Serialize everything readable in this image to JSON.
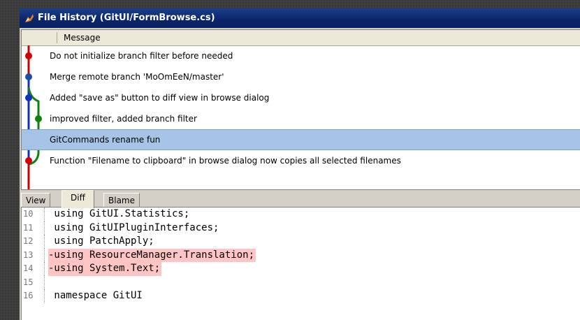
{
  "window": {
    "title": "File History (GitUI/FormBrowse.cs)",
    "icon": "git-icon"
  },
  "history": {
    "column_header": "Message",
    "selected_index": 4,
    "commits": [
      {
        "message": "Do not initialize branch filter before needed"
      },
      {
        "message": "Merge remote branch 'MoOmEeN/master'"
      },
      {
        "message": "Added \"save as\" button to diff view in browse dialog"
      },
      {
        "message": "improved filter, added branch filter"
      },
      {
        "message": "GitCommands rename fun"
      },
      {
        "message": "Function \"Filename to clipboard\" in browse dialog now copies all selected filenames"
      },
      {
        "message": ""
      }
    ],
    "graph_colors": {
      "red": "#d00000",
      "blue": "#1030c0",
      "green": "#108010"
    }
  },
  "tabs": [
    {
      "label": "View"
    },
    {
      "label": "Diff"
    },
    {
      "label": "Blame"
    }
  ],
  "active_tab": "Diff",
  "diff": {
    "lines": [
      {
        "num": "10",
        "text": " using GitUI.Statistics;",
        "type": "context"
      },
      {
        "num": "11",
        "text": " using GitUIPluginInterfaces;",
        "type": "context"
      },
      {
        "num": "12",
        "text": " using PatchApply;",
        "type": "context"
      },
      {
        "num": "13",
        "text": "-using ResourceManager.Translation;",
        "type": "removed"
      },
      {
        "num": "14",
        "text": "-using System.Text;",
        "type": "removed"
      },
      {
        "num": "15",
        "text": "",
        "type": "context"
      },
      {
        "num": "16",
        "text": " namespace GitUI",
        "type": "context"
      }
    ],
    "removed_color": "#ffc4c4"
  }
}
